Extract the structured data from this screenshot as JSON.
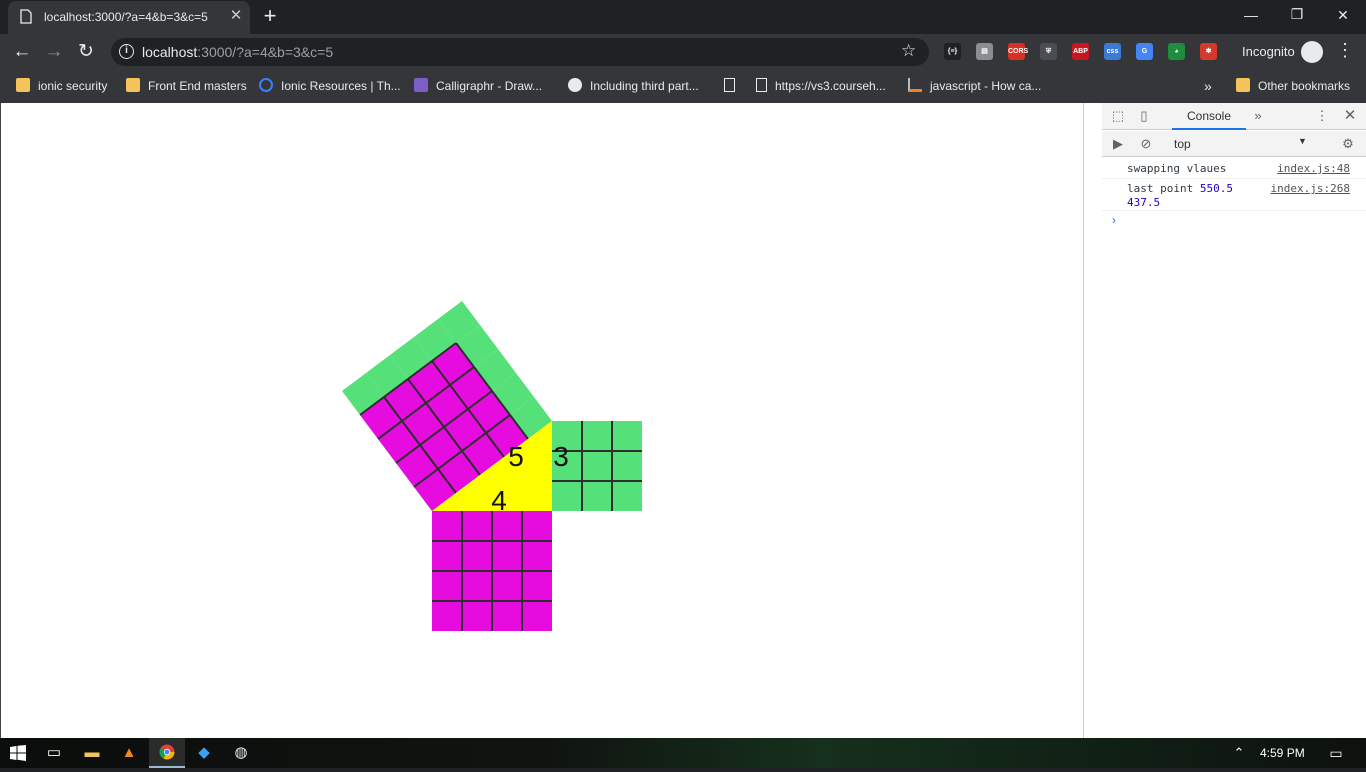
{
  "tab": {
    "title": "localhost:3000/?a=4&b=3&c=5",
    "close": "✕",
    "new_tab": "+"
  },
  "window_controls": {
    "minimize": "—",
    "restore": "❐",
    "close": "✕"
  },
  "toolbar": {
    "back": "←",
    "forward": "→",
    "reload": "↻",
    "star": "☆",
    "menu": "⋮"
  },
  "omnibox": {
    "info": "i",
    "host": "localhost",
    "rest": ":3000/?a=4&b=3&c=5"
  },
  "extensions": [
    {
      "name": "json-ext-icon",
      "label": "{≡}",
      "color": "#202124"
    },
    {
      "name": "ext-square-icon",
      "label": "▤",
      "color": "#8a8d91"
    },
    {
      "name": "cors-icon",
      "label": "CORS",
      "color": "#d93025"
    },
    {
      "name": "shield-ext-icon",
      "label": "⛨",
      "color": "#4a4d52"
    },
    {
      "name": "abp-icon",
      "label": "ABP",
      "color": "#c8171e"
    },
    {
      "name": "css-ext-icon",
      "label": "css",
      "color": "#3a7bd5"
    },
    {
      "name": "translate-icon",
      "label": "G",
      "color": "#4285f4"
    },
    {
      "name": "globe-ext-icon",
      "label": "◕",
      "color": "#1e8e3e"
    },
    {
      "name": "puzzle-ext-icon",
      "label": "✱",
      "color": "#d33a2c"
    }
  ],
  "incognito": {
    "label": "Incognito"
  },
  "bookmarks": {
    "items": [
      {
        "label": "ionic security",
        "icon": "folder"
      },
      {
        "label": "Front End masters",
        "icon": "folder"
      },
      {
        "label": "Ionic Resources | Th...",
        "icon": "ionic"
      },
      {
        "label": "Calligraphr - Draw...",
        "icon": "cg"
      },
      {
        "label": "Including third part...",
        "icon": "github"
      },
      {
        "label": "",
        "icon": "page"
      },
      {
        "label": "https://vs3.courseh...",
        "icon": "page"
      },
      {
        "label": "javascript - How ca...",
        "icon": "stack"
      }
    ],
    "overflow": "»",
    "other": "Other bookmarks"
  },
  "triangle": {
    "a": 4,
    "b": 3,
    "c": 5,
    "label_a": "4",
    "label_b": "3",
    "label_c": "5"
  },
  "colors": {
    "green": "#55e07a",
    "magenta": "#e60ce0",
    "yellow": "#ffff00",
    "grid": "#2e2e2e"
  },
  "devtools": {
    "console_tab": "Console",
    "more_tabs": "»",
    "context": "top",
    "context_arrow": "▼",
    "messages": [
      {
        "text": "swapping vlaues",
        "source": "index.js:48"
      },
      {
        "text": "last point ",
        "num1": "550.5",
        "num2": "437.5",
        "source": "index.js:268"
      }
    ],
    "prompt": "›"
  },
  "taskbar": {
    "time": "4:59 PM"
  }
}
